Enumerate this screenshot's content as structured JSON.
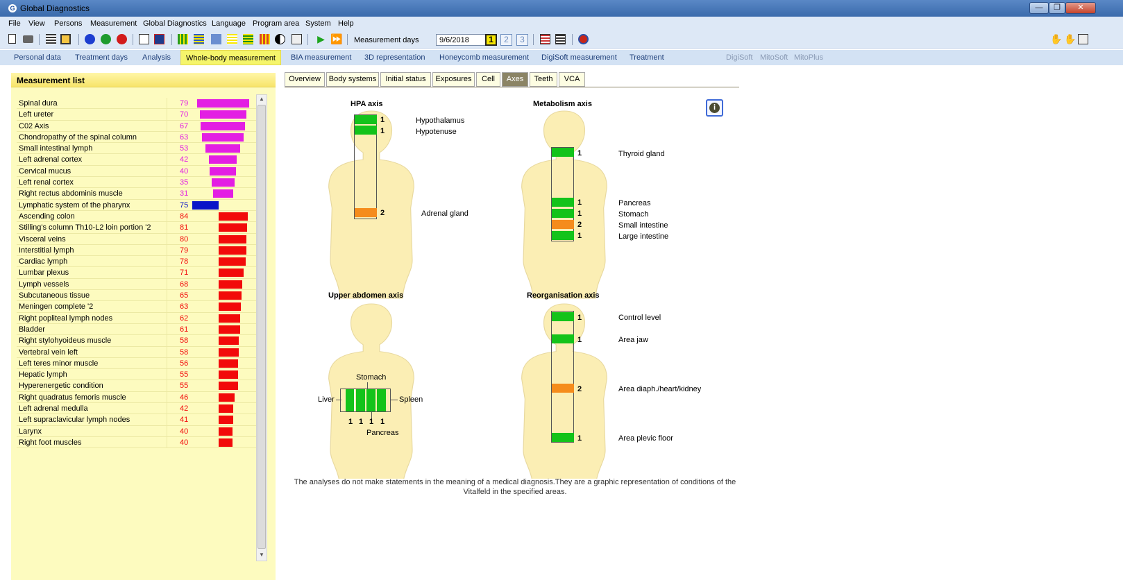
{
  "window": {
    "title": "Global Diagnostics",
    "minimize": "—",
    "restore": "❐",
    "close": "✕"
  },
  "menu": [
    "File",
    "View",
    "Persons",
    "Measurement",
    "Global Diagnostics",
    "Language",
    "Program area",
    "System",
    "Help"
  ],
  "toolbar": {
    "measurement_days_label": "Measurement days",
    "date_value": "9/6/2018",
    "day_buttons": [
      "1",
      "2",
      "3"
    ]
  },
  "nav": {
    "tabs": [
      "Personal data",
      "Treatment days",
      "Analysis",
      "Whole-body measurement",
      "BIA measurement",
      "3D representation",
      "Honeycomb measurement",
      "DigiSoft measurement",
      "Treatment"
    ],
    "active": "Whole-body measurement",
    "disabled": [
      "DigiSoft",
      "MitoSoft",
      "MitoPlus"
    ]
  },
  "measurement_list": {
    "title": "Measurement list",
    "colors": {
      "magenta": "#e31ee3",
      "blue": "#0a14c8",
      "red": "#f20a0a"
    },
    "items": [
      {
        "name": "Spinal dura",
        "value": "79",
        "color": "magenta"
      },
      {
        "name": "Left ureter",
        "value": "70",
        "color": "magenta"
      },
      {
        "name": "C02 Axis",
        "value": "67",
        "color": "magenta"
      },
      {
        "name": "Chondropathy of the spinal column",
        "value": "63",
        "color": "magenta"
      },
      {
        "name": "Small intestinal lymph",
        "value": "53",
        "color": "magenta"
      },
      {
        "name": "Left adrenal cortex",
        "value": "42",
        "color": "magenta"
      },
      {
        "name": "Cervical mucus",
        "value": "40",
        "color": "magenta"
      },
      {
        "name": "Left renal cortex",
        "value": "35",
        "color": "magenta"
      },
      {
        "name": "Right rectus abdominis muscle",
        "value": "31",
        "color": "magenta"
      },
      {
        "name": "Lymphatic system of the pharynx",
        "value": "75",
        "color": "blue"
      },
      {
        "name": "Ascending colon",
        "value": "84",
        "color": "red"
      },
      {
        "name": "Stilling's column Th10-L2 loin portion '2",
        "value": "81",
        "color": "red"
      },
      {
        "name": "Visceral veins",
        "value": "80",
        "color": "red"
      },
      {
        "name": "Interstitial lymph",
        "value": "79",
        "color": "red"
      },
      {
        "name": "Cardiac lymph",
        "value": "78",
        "color": "red"
      },
      {
        "name": "Lumbar plexus",
        "value": "71",
        "color": "red"
      },
      {
        "name": "Lymph vessels",
        "value": "68",
        "color": "red"
      },
      {
        "name": "Subcutaneous tissue",
        "value": "65",
        "color": "red"
      },
      {
        "name": "Meningen complete '2",
        "value": "63",
        "color": "red"
      },
      {
        "name": "Right popliteal lymph nodes",
        "value": "62",
        "color": "red"
      },
      {
        "name": "Bladder",
        "value": "61",
        "color": "red"
      },
      {
        "name": "Right stylohyoideus muscle",
        "value": "58",
        "color": "red"
      },
      {
        "name": "Vertebral vein left",
        "value": "58",
        "color": "red"
      },
      {
        "name": "Left teres minor muscle",
        "value": "56",
        "color": "red"
      },
      {
        "name": "Hepatic lymph",
        "value": "55",
        "color": "red"
      },
      {
        "name": "Hyperenergetic condition",
        "value": "55",
        "color": "red"
      },
      {
        "name": "Right quadratus femoris muscle",
        "value": "46",
        "color": "red"
      },
      {
        "name": "Left adrenal medulla",
        "value": "42",
        "color": "red"
      },
      {
        "name": "Left supraclavicular lymph nodes",
        "value": "41",
        "color": "red"
      },
      {
        "name": "Larynx",
        "value": "40",
        "color": "red"
      },
      {
        "name": "Right foot muscles",
        "value": "40",
        "color": "red"
      }
    ]
  },
  "subtabs": {
    "items": [
      "Overview",
      "Body systems",
      "Initial status",
      "Exposures",
      "Cell",
      "Axes",
      "Teeth",
      "VCA"
    ],
    "active": "Axes"
  },
  "axes": {
    "level_colors": {
      "1": "#13c31a",
      "2": "#f58c1c"
    },
    "hpa": {
      "title": "HPA axis",
      "segments": [
        {
          "label": "Hypothalamus",
          "value": "1"
        },
        {
          "label": "Hypotenuse",
          "value": "1"
        },
        {
          "label": "Adrenal gland",
          "value": "2"
        }
      ]
    },
    "metabolism": {
      "title": "Metabolism axis",
      "segments": [
        {
          "label": "Thyroid gland",
          "value": "1"
        },
        {
          "label": "Pancreas",
          "value": "1"
        },
        {
          "label": "Stomach",
          "value": "1"
        },
        {
          "label": "Small intestine",
          "value": "2"
        },
        {
          "label": "Large intestine",
          "value": "1"
        }
      ]
    },
    "upper_abdomen": {
      "title": "Upper abdomen axis",
      "labels": {
        "liver": "Liver",
        "stomach": "Stomach",
        "spleen": "Spleen",
        "pancreas": "Pancreas"
      },
      "values": [
        "1",
        "1",
        "1",
        "1"
      ]
    },
    "reorganisation": {
      "title": "Reorganisation axis",
      "segments": [
        {
          "label": "Control level",
          "value": "1"
        },
        {
          "label": "Area jaw",
          "value": "1"
        },
        {
          "label": "Area diaph./heart/kidney",
          "value": "2"
        },
        {
          "label": "Area plevic floor",
          "value": "1"
        }
      ]
    }
  },
  "info_icon": "info-icon",
  "disclaimer": "The analyses do not make statements in the meaning of a medical diagnosis.They are a graphic representation of conditions of the Vitalfeld in the specified areas."
}
